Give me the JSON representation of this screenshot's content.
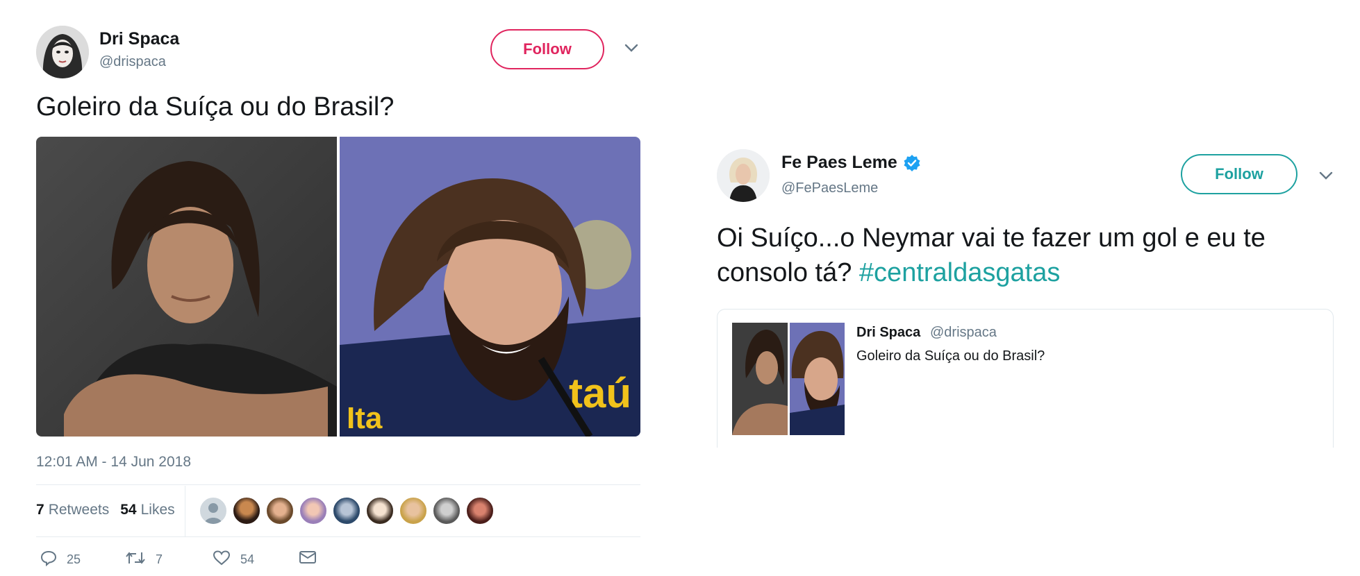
{
  "tweet1": {
    "name": "Dri Spaca",
    "handle": "@drispaca",
    "follow_label": "Follow",
    "text": "Goleiro da Suíça ou do Brasil?",
    "timestamp": "12:01 AM - 14 Jun 2018",
    "retweets_count": "7",
    "retweets_label": "Retweets",
    "likes_count": "54",
    "likes_label": "Likes",
    "liker_avatars": 9,
    "actions": {
      "replies": "25",
      "retweets": "7",
      "likes": "54"
    },
    "icons": [
      "reply-icon",
      "retweet-icon",
      "like-icon",
      "message-icon",
      "chevron-down-icon"
    ]
  },
  "tweet2": {
    "name": "Fe Paes Leme",
    "verified": true,
    "handle": "@FePaesLeme",
    "follow_label": "Follow",
    "text": "Oi Suíço...o Neymar vai te fazer um gol e eu te consolo tá? ",
    "hashtag": "#centraldasgatas",
    "quoted": {
      "name": "Dri Spaca",
      "handle": "@drispaca",
      "text": "Goleiro da Suíça ou do Brasil?"
    }
  },
  "colors": {
    "follow_red": "#e0245e",
    "follow_teal": "#1da1a0",
    "hashtag": "#1da1a0",
    "verified": "#1da1f2",
    "muted": "#657786"
  }
}
